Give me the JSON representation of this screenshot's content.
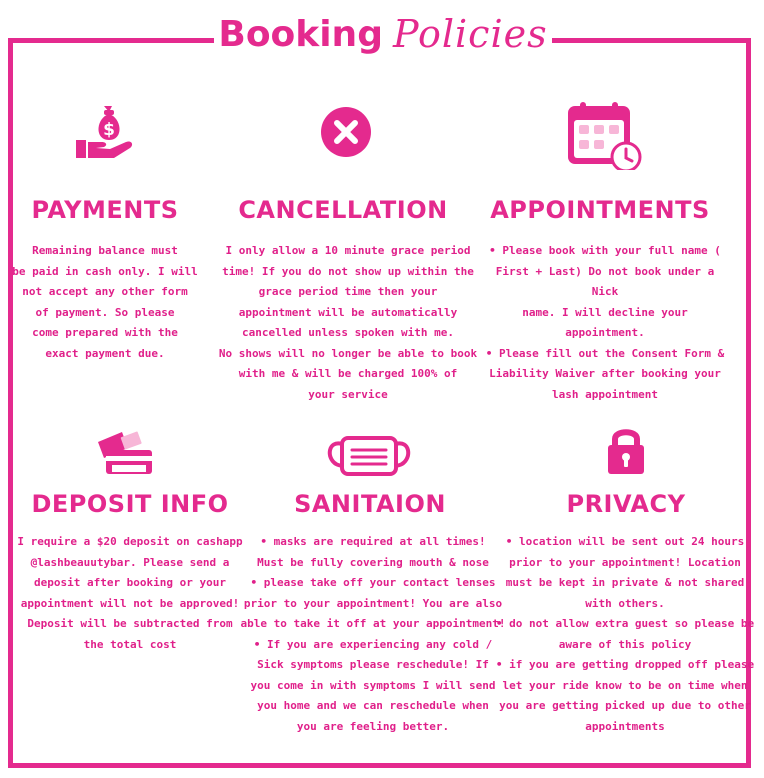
{
  "title": {
    "bold": "Booking",
    "script": "Policies"
  },
  "colors": {
    "accent": "#e42a8e",
    "light": "#f7b6d7"
  },
  "sections": {
    "payments": {
      "icon": "hand-money-bag-icon",
      "heading": "PAYMENTS",
      "lines": [
        "Remaining balance must",
        "be paid in cash only. I will",
        "not accept any other form",
        "of payment. So please",
        "come prepared with the",
        "exact payment due."
      ]
    },
    "cancellation": {
      "icon": "cancel-x-icon",
      "heading": "CANCELLATION",
      "lines": [
        "I only allow a 10 minute grace period",
        "time! If you do not show up within the",
        "grace period time then your",
        "appointment will be automatically",
        "cancelled unless spoken with me.",
        "No shows will no longer be able to book",
        "with me & will be charged 100% of",
        "your service"
      ]
    },
    "appointments": {
      "icon": "calendar-clock-icon",
      "heading": "APPOINTMENTS",
      "lines": [
        "• Please book with your full name (",
        "First + Last) Do not book under a Nick",
        "name. I will decline your appointment.",
        "• Please fill out the Consent Form &",
        "Liability Waiver after booking your",
        "lash appointment"
      ]
    },
    "deposit": {
      "icon": "credit-card-icon",
      "heading": "DEPOSIT INFO",
      "lines": [
        "I require a $20 deposit on cashapp",
        "@lashbeauutybar. Please send a",
        "deposit after booking or your",
        "appointment will not be approved!",
        "Deposit will be subtracted from",
        "the total cost"
      ]
    },
    "sanitation": {
      "icon": "face-mask-icon",
      "heading": "SANITAION",
      "lines": [
        "• masks are required at all times!",
        "Must be fully covering mouth & nose",
        "• please take off your contact lenses",
        "prior to your appointment! You are also",
        "able to take it off at your appointment!",
        "• If you are experiencing any cold /",
        "Sick symptoms please reschedule! If",
        "you come in with symptoms I will send",
        "you home and we can reschedule when",
        "you are feeling better."
      ]
    },
    "privacy": {
      "icon": "padlock-icon",
      "heading": "PRIVACY",
      "lines": [
        "• location will be sent out 24 hours",
        "prior to your appointment! Location",
        "must be kept in private & not shared",
        "with others.",
        "• do not allow extra guest so please be",
        "aware of this policy",
        "• if you are getting dropped off please",
        "let your ride know to be on time when",
        "you are getting picked up due to other",
        "appointments"
      ]
    }
  }
}
